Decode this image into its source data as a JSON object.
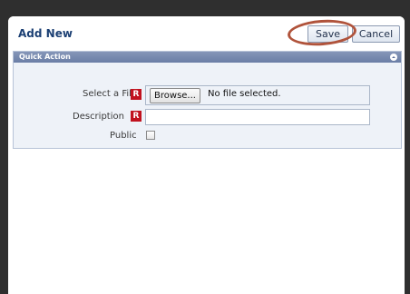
{
  "dialog": {
    "title": "Add New",
    "save_label": "Save",
    "cancel_label": "Cancel"
  },
  "panel": {
    "title": "Quick Action"
  },
  "form": {
    "file_label": "Select a File",
    "required_marker": "R",
    "browse_label": "Browse...",
    "file_status": "No file selected.",
    "description_label": "Description",
    "description_value": "",
    "public_label": "Public",
    "public_checked": false
  },
  "icons": {
    "collapse": "chevron-up-icon"
  },
  "colors": {
    "title": "#1b3f73",
    "panel_header": "#6a7ea6",
    "required": "#c1121f",
    "highlight": "#b0533b"
  }
}
